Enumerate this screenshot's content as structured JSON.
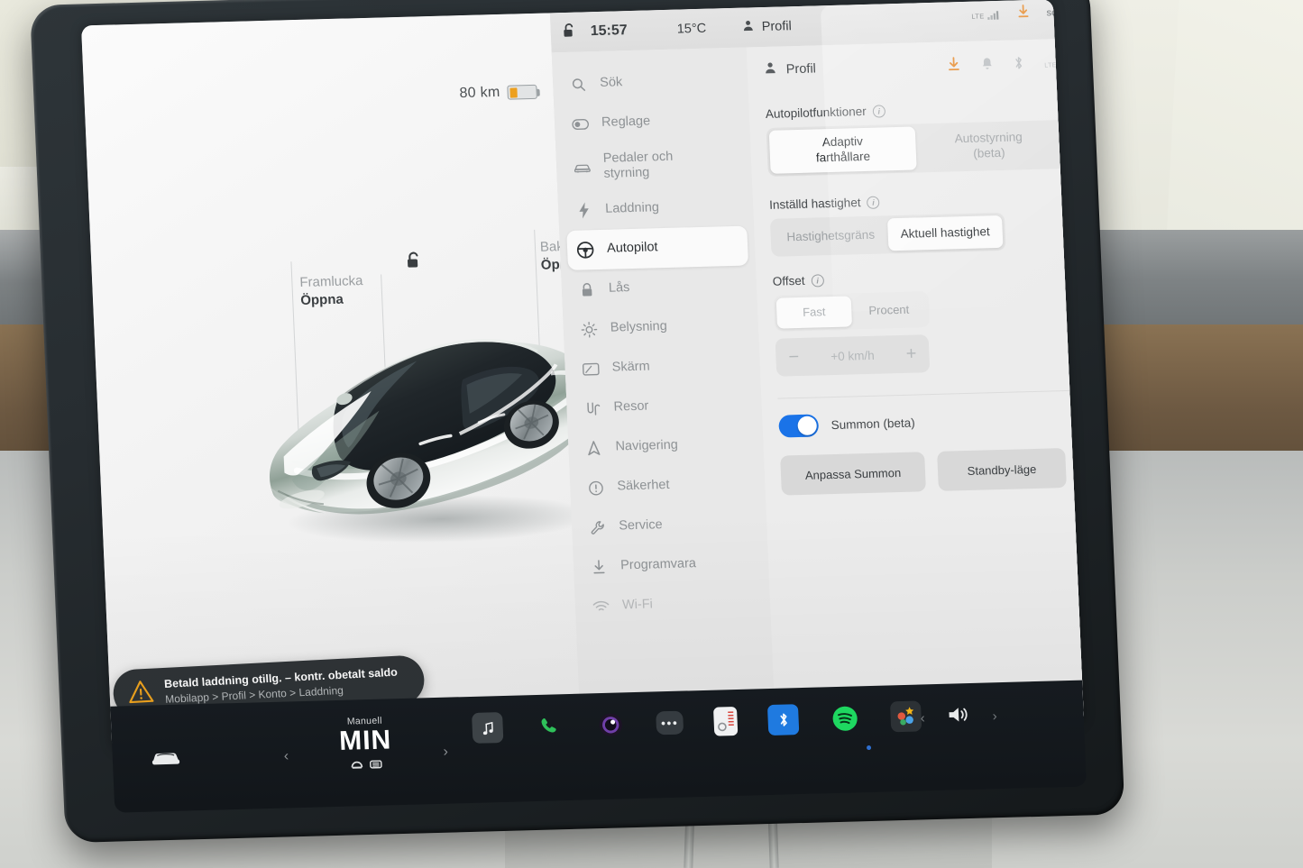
{
  "vehicle": {
    "range_text": "80 km",
    "front_trunk": {
      "title": "Framlucka",
      "action": "Öppna"
    },
    "rear_trunk": {
      "title": "Baklucka",
      "action": "Öppna"
    },
    "lock_state_icon": "unlocked-padlock-icon",
    "charge_port_icon": "lightning-bolt-icon"
  },
  "toast": {
    "title": "Betald laddning otillg. – kontr. obetalt saldo",
    "subtitle": "Mobilapp > Profil > Konto > Laddning",
    "icon": "warning-triangle-icon",
    "accent": "#f0a41e"
  },
  "status_bar": {
    "unlock_icon": "unlocked-padlock-icon",
    "time": "15:57",
    "temperature": "15°C",
    "profile_icon": "person-icon",
    "profile_label": "Profil",
    "right_icons": [
      "lte-signal-icon",
      "download-icon",
      "sos-icon"
    ],
    "lte_label": "LTE",
    "sos_label": "SOS"
  },
  "sidebar": {
    "items": [
      {
        "label": "Sök",
        "icon": "search-icon",
        "active": false
      },
      {
        "label": "Reglage",
        "icon": "toggle-icon",
        "active": false
      },
      {
        "label": "Pedaler och\nstyrning",
        "icon": "car-front-icon",
        "active": false
      },
      {
        "label": "Laddning",
        "icon": "lightning-bolt-icon",
        "active": false
      },
      {
        "label": "Autopilot",
        "icon": "steering-wheel-icon",
        "active": true
      },
      {
        "label": "Lås",
        "icon": "lock-icon",
        "active": false
      },
      {
        "label": "Belysning",
        "icon": "sun-icon",
        "active": false
      },
      {
        "label": "Skärm",
        "icon": "display-icon",
        "active": false
      },
      {
        "label": "Resor",
        "icon": "trips-icon",
        "active": false
      },
      {
        "label": "Navigering",
        "icon": "navigation-arrow-icon",
        "active": false
      },
      {
        "label": "Säkerhet",
        "icon": "exclamation-circle-icon",
        "active": false
      },
      {
        "label": "Service",
        "icon": "wrench-icon",
        "active": false
      },
      {
        "label": "Programvara",
        "icon": "download-icon",
        "active": false
      },
      {
        "label": "Wi-Fi",
        "icon": "wifi-icon",
        "active": false
      }
    ]
  },
  "content": {
    "header": {
      "icon": "person-icon",
      "label": "Profil"
    },
    "status_icons": [
      "download-icon",
      "bell-icon",
      "bluetooth-icon",
      "lte-signal-icon"
    ],
    "lte_small_label": "LTE",
    "sections": {
      "autopilot_features": {
        "label": "Autopilotfunktioner",
        "options": [
          {
            "label": "Adaptiv\nfarthållare",
            "selected": true
          },
          {
            "label": "Autostyrning\n(beta)",
            "selected": false
          }
        ]
      },
      "set_speed": {
        "label": "Inställd hastighet",
        "options": [
          {
            "label": "Hastighetsgräns",
            "selected": false
          },
          {
            "label": "Aktuell hastighet",
            "selected": true
          }
        ]
      },
      "offset": {
        "label": "Offset",
        "options": [
          {
            "label": "Fast",
            "selected": true
          },
          {
            "label": "Procent",
            "selected": false
          }
        ],
        "stepper": {
          "minus": "−",
          "value": "+0 km/h",
          "plus": "+"
        }
      },
      "summon": {
        "toggle_label": "Summon (beta)",
        "toggle_on": true,
        "toggle_color": "#1a73e8",
        "buttons": [
          {
            "label": "Anpassa Summon"
          },
          {
            "label": "Standby-läge"
          }
        ]
      }
    }
  },
  "dock": {
    "car_icon": "car-front-icon",
    "climate": {
      "mode": "Manuell",
      "value": "MIN",
      "prev_arrow": "‹",
      "next_arrow": "›",
      "seat_icons": [
        "seat-heater-icon",
        "rear-defrost-icon"
      ]
    },
    "apps": [
      {
        "name": "media-app-icon",
        "glyph": "♪"
      },
      {
        "name": "phone-app-icon",
        "glyph": "📞"
      },
      {
        "name": "camera-app-icon",
        "glyph": "●"
      },
      {
        "name": "more-apps-icon",
        "glyph": "•••"
      },
      {
        "name": "climate-app-icon",
        "glyph": "▤"
      },
      {
        "name": "bluetooth-app-icon",
        "glyph": "ᛒ"
      },
      {
        "name": "spotify-app-icon",
        "glyph": "≋"
      },
      {
        "name": "toybox-app-icon",
        "glyph": "★"
      }
    ],
    "volume": {
      "icon": "speaker-icon",
      "prev_arrow": "‹",
      "next_arrow": "›"
    }
  }
}
